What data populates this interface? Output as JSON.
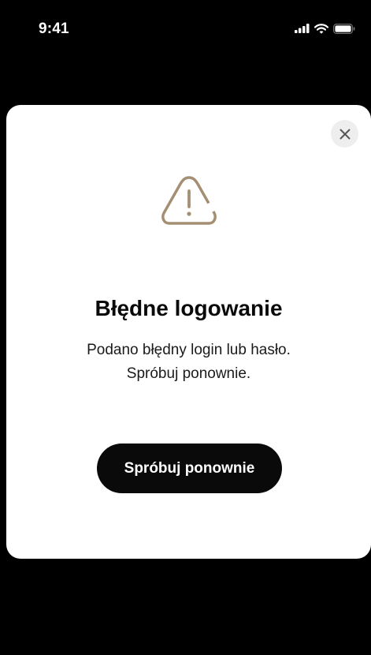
{
  "status_bar": {
    "time": "9:41",
    "icons": [
      "signal-icon",
      "wifi-icon",
      "battery-icon"
    ]
  },
  "modal": {
    "close_icon": "close-icon",
    "icon": "warning-icon",
    "title": "Błędne logowanie",
    "message_lines": [
      "Podano błędny login lub hasło.",
      "Spróbuj ponownie."
    ],
    "retry_label": "Spróbuj ponownie"
  },
  "colors": {
    "background": "#000000",
    "modal": "#ffffff",
    "accent_icon": "#a58f72",
    "button": "#0a0a0a",
    "close_bg": "#eeeeee"
  }
}
